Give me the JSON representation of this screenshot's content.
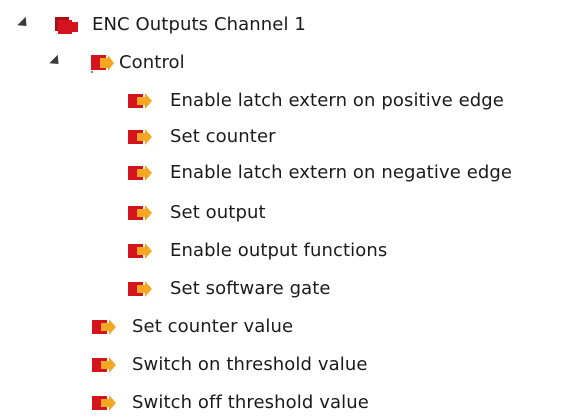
{
  "tree": {
    "root": {
      "label": "ENC Outputs Channel 1",
      "icon": "channel-folder-icon",
      "expanded": true,
      "children": [
        {
          "label": "Control",
          "icon": "output-folder-icon",
          "expanded": true,
          "children": [
            {
              "label": "Enable latch extern on positive edge",
              "icon": "output-variable-icon"
            },
            {
              "label": "Set counter",
              "icon": "output-variable-icon"
            },
            {
              "label": "Enable latch extern on negative edge",
              "icon": "output-variable-icon"
            },
            {
              "label": "Set output",
              "icon": "output-variable-icon"
            },
            {
              "label": "Enable output functions",
              "icon": "output-variable-icon"
            },
            {
              "label": "Set software gate",
              "icon": "output-variable-icon"
            }
          ]
        },
        {
          "label": "Set counter value",
          "icon": "output-variable-icon"
        },
        {
          "label": "Switch on threshold value",
          "icon": "output-variable-icon"
        },
        {
          "label": "Switch off threshold value",
          "icon": "output-variable-icon"
        }
      ]
    }
  },
  "colors": {
    "icon_red": "#d4141c",
    "icon_red_dark": "#a90f15",
    "icon_arrow": "#f5a623",
    "text": "#1a1a1a",
    "expander": "#3a3a3a"
  }
}
